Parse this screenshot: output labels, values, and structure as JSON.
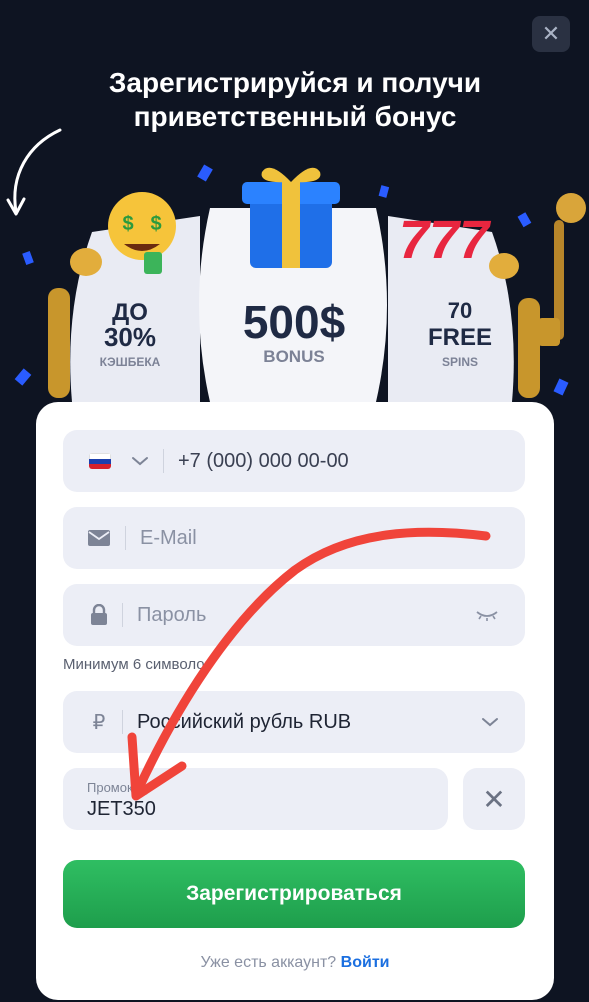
{
  "header": {
    "close_icon": "close-icon",
    "close_glyph": "✕",
    "title_line1": "Зарегистрируйся и получи",
    "title_line2": "приветственный бонус"
  },
  "banner": {
    "left_reel": {
      "line1": "ДО",
      "line2": "30%",
      "line3": "КЭШБЕКА"
    },
    "center_reel": {
      "line1": "500$",
      "line2": "BONUS"
    },
    "right_reel": {
      "line1": "70",
      "line2": "FREE",
      "line3": "SPINS"
    },
    "icons": [
      "money-face-icon",
      "gift-icon",
      "sevens-icon",
      "coin-icon",
      "lever-icon"
    ]
  },
  "form": {
    "phone": {
      "country": "RU",
      "chevron": "chevron-down-icon",
      "placeholder": "+7 (000) 000 00-00"
    },
    "email": {
      "icon": "envelope-icon",
      "placeholder": "E-Mail"
    },
    "password": {
      "icon": "lock-icon",
      "placeholder": "Пароль",
      "toggle_icon": "eye-closed-icon"
    },
    "password_hint": "Минимум 6 символов",
    "currency": {
      "icon": "ruble-icon",
      "symbol": "₽",
      "value": "Российский рубль RUB",
      "chevron": "chevron-down-icon"
    },
    "promo": {
      "label": "Промокод",
      "value": "JET350",
      "clear_glyph": "✕"
    },
    "submit_label": "Зарегистрироваться",
    "login_prompt": "Уже есть аккаунт?",
    "login_link": "Войти"
  },
  "colors": {
    "background": "#0e1422",
    "card": "#ffffff",
    "field": "#eceef6",
    "primary_button": "#27b259",
    "link": "#1b6fe0",
    "annotation_arrow": "#f0443a"
  }
}
